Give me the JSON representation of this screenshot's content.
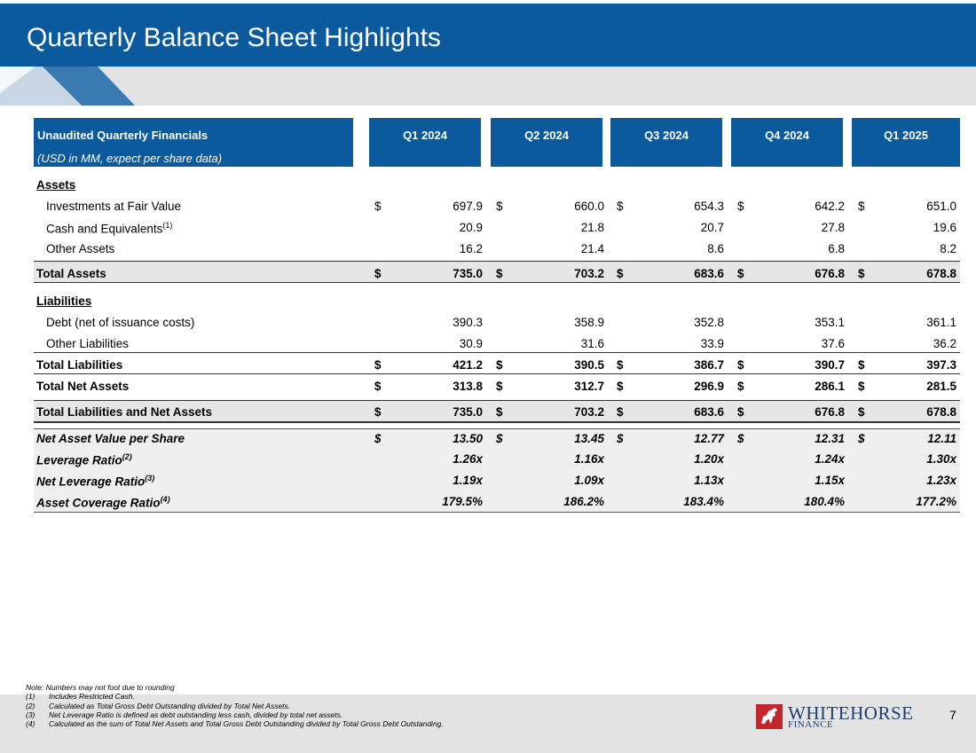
{
  "title": "Quarterly Balance Sheet Highlights",
  "header": {
    "label_line1": "Unaudited Quarterly Financials",
    "label_line2": "(USD in MM, expect per share data)",
    "quarters": [
      "Q1 2024",
      "Q2 2024",
      "Q3 2024",
      "Q4 2024",
      "Q1 2025"
    ]
  },
  "rows": {
    "assets_heading": "Assets",
    "investments": {
      "label": "Investments at Fair Value",
      "cur": "$",
      "values": [
        "697.9",
        "660.0",
        "654.3",
        "642.2",
        "651.0"
      ]
    },
    "cash": {
      "label": "Cash and Equivalents",
      "sup": "(1)",
      "values": [
        "20.9",
        "21.8",
        "20.7",
        "27.8",
        "19.6"
      ]
    },
    "other_assets": {
      "label": "Other Assets",
      "values": [
        "16.2",
        "21.4",
        "8.6",
        "6.8",
        "8.2"
      ]
    },
    "total_assets": {
      "label": "Total Assets",
      "cur": "$",
      "values": [
        "735.0",
        "703.2",
        "683.6",
        "676.8",
        "678.8"
      ]
    },
    "liabilities_heading": "Liabilities",
    "debt": {
      "label": "Debt (net of issuance costs)",
      "values": [
        "390.3",
        "358.9",
        "352.8",
        "353.1",
        "361.1"
      ]
    },
    "other_liabilities": {
      "label": "Other Liabilities",
      "values": [
        "30.9",
        "31.6",
        "33.9",
        "37.6",
        "36.2"
      ]
    },
    "total_liabilities": {
      "label": "Total Liabilities",
      "cur": "$",
      "values": [
        "421.2",
        "390.5",
        "386.7",
        "390.7",
        "397.3"
      ]
    },
    "total_net_assets": {
      "label": "Total Net Assets",
      "cur": "$",
      "values": [
        "313.8",
        "312.7",
        "296.9",
        "286.1",
        "281.5"
      ]
    },
    "total_liab_net": {
      "label": "Total Liabilities and Net Assets",
      "cur": "$",
      "values": [
        "735.0",
        "703.2",
        "683.6",
        "676.8",
        "678.8"
      ]
    },
    "nav": {
      "label": "Net Asset Value per Share",
      "cur": "$",
      "values": [
        "13.50",
        "13.45",
        "12.77",
        "12.31",
        "12.11"
      ]
    },
    "leverage": {
      "label": "Leverage Ratio",
      "sup": "(2)",
      "values": [
        "1.26x",
        "1.16x",
        "1.20x",
        "1.24x",
        "1.30x"
      ]
    },
    "net_leverage": {
      "label": "Net Leverage Ratio",
      "sup": "(3)",
      "values": [
        "1.19x",
        "1.09x",
        "1.13x",
        "1.15x",
        "1.23x"
      ]
    },
    "asset_coverage": {
      "label": "Asset Coverage Ratio",
      "sup": "(4)",
      "values": [
        "179.5%",
        "186.2%",
        "183.4%",
        "180.4%",
        "177.2%"
      ]
    }
  },
  "notes": {
    "note": "Note: Numbers may not foot due to rounding",
    "items": [
      {
        "num": "(1)",
        "text": "Includes Restricted Cash."
      },
      {
        "num": "(2)",
        "text": "Calculated as Total Gross Debt Outstanding divided by Total Net Assets."
      },
      {
        "num": "(3)",
        "text": "Net Leverage Ratio is defined as debt outstanding less cash, divided by total net assets."
      },
      {
        "num": "(4)",
        "text": "Calculated as the sum of Total Net Assets and Total Gross Debt Outstanding divided by Total Gross Debt Outstanding."
      }
    ]
  },
  "logo": {
    "line1": "WHITEHORSE",
    "line2": "FINANCE",
    "icon": "horse-icon"
  },
  "page_number": "7",
  "colors": {
    "brand_blue": "#0b5a9e",
    "band_gray": "#e3e3e3",
    "logo_red": "#c4262e",
    "logo_navy": "#1c3f73"
  }
}
